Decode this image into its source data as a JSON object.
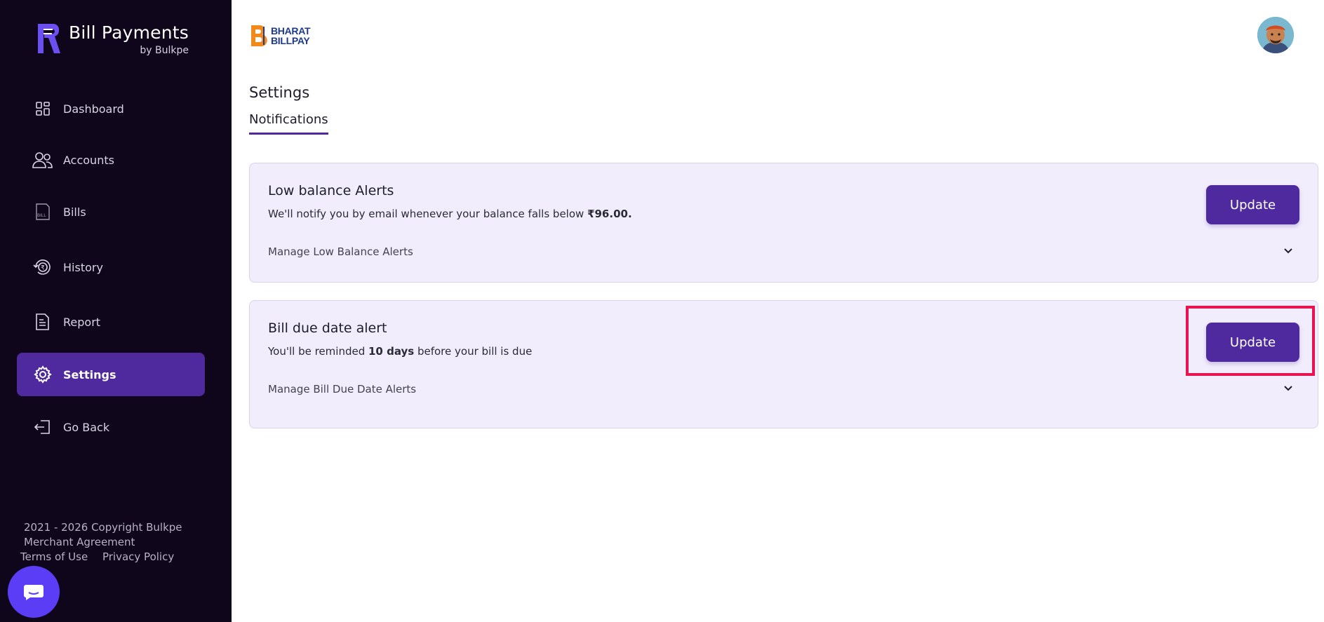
{
  "brand": {
    "title": "Bill Payments",
    "subtitle": "by Bulkpe"
  },
  "sidebar": {
    "items": [
      {
        "label": "Dashboard",
        "icon": "dashboard-grid-icon"
      },
      {
        "label": "Accounts",
        "icon": "users-icon"
      },
      {
        "label": "Bills",
        "icon": "bill-icon"
      },
      {
        "label": "History",
        "icon": "history-icon"
      },
      {
        "label": "Report",
        "icon": "report-icon"
      },
      {
        "label": "Settings",
        "icon": "gear-icon",
        "active": true
      },
      {
        "label": "Go Back",
        "icon": "exit-icon"
      }
    ],
    "footer": {
      "copyright": "2021 - 2026 Copyright Bulkpe",
      "merchant_agreement": "Merchant Agreement",
      "terms": "Terms of Use",
      "privacy": "Privacy Policy"
    }
  },
  "header": {
    "logo_line1": "BHARAT",
    "logo_line2": "BILLPAY"
  },
  "page": {
    "title": "Settings",
    "tab": "Notifications"
  },
  "cards": [
    {
      "title": "Low balance Alerts",
      "desc_prefix": "We'll notify you by email whenever your balance falls below ",
      "desc_bold": "₹96.00.",
      "desc_suffix": "",
      "manage": "Manage Low Balance Alerts",
      "button": "Update"
    },
    {
      "title": "Bill due date alert",
      "desc_prefix": "You'll be reminded ",
      "desc_bold": "10 days",
      "desc_suffix": " before your bill is due",
      "manage": "Manage Bill Due Date Alerts",
      "button": "Update"
    }
  ],
  "colors": {
    "sidebar_bg": "#0f061c",
    "accent": "#4f2a9e",
    "card_bg": "#f1edfc",
    "highlight": "#e8144f",
    "chat": "#5b3df5"
  }
}
